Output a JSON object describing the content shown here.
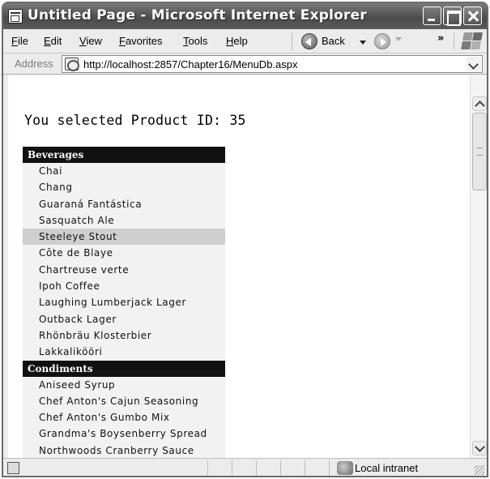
{
  "window": {
    "title": "Untitled Page - Microsoft Internet Explorer"
  },
  "menubar": {
    "items": [
      "File",
      "Edit",
      "View",
      "Favorites",
      "Tools",
      "Help"
    ],
    "back_label": "Back",
    "more_label": "»"
  },
  "addressbar": {
    "label": "Address",
    "url": "http://localhost:2857/Chapter16/MenuDb.aspx"
  },
  "page": {
    "selected_message": "You selected Product ID: 35",
    "menu": [
      {
        "category": "Beverages",
        "products": [
          "Chai",
          "Chang",
          "Guaraná Fantástica",
          "Sasquatch Ale",
          "Steeleye Stout",
          "Côte de Blaye",
          "Chartreuse verte",
          "Ipoh Coffee",
          "Laughing Lumberjack Lager",
          "Outback Lager",
          "Rhönbräu Klosterbier",
          "Lakkalikööri"
        ]
      },
      {
        "category": "Condiments",
        "products": [
          "Aniseed Syrup",
          "Chef Anton's Cajun Seasoning",
          "Chef Anton's Gumbo Mix",
          "Grandma's Boysenberry Spread",
          "Northwoods Cranberry Sauce"
        ]
      }
    ],
    "selected_product": "Steeleye Stout"
  },
  "statusbar": {
    "zone": "Local intranet"
  }
}
